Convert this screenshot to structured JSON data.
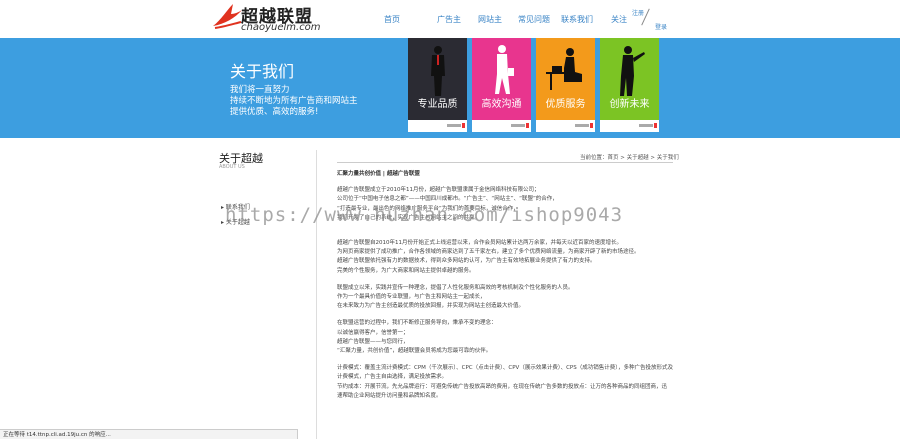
{
  "header": {
    "logo_cn": "超越联盟",
    "logo_en": "chaoyuelm.com",
    "nav": [
      "首页",
      "广告主",
      "网站主",
      "常见问题",
      "联系我们",
      "关注"
    ],
    "login": "注册",
    "register": "登录"
  },
  "banner": {
    "title": "关于我们",
    "desc": [
      "我们将一直努力",
      "持续不断地为所有广告商和网站主",
      "提供优质、高效的服务!"
    ],
    "cards": [
      {
        "label": "专业品质",
        "color": "#2b2b33"
      },
      {
        "label": "高效沟通",
        "color": "#e8358e"
      },
      {
        "label": "优质服务",
        "color": "#f39a1b"
      },
      {
        "label": "创新未来",
        "color": "#7cc424"
      }
    ]
  },
  "sidebar": {
    "title": "关于超越",
    "subtitle": "ABOUT US",
    "items": [
      "联系我们",
      "关于超越"
    ]
  },
  "breadcrumb": "当前位置：首页 > 关于超越 > 关于我们",
  "article": {
    "heading": "汇聚力量共创价值 | 超越广告联盟",
    "p1": [
      "超越广告联盟成立于2010年11月份，超越广告联盟隶属于金信网络科技有限公司；",
      "公司位于“中国电子信息之都”——中国四川成都市。“广告主”、“网站主”、“联盟”的合作，",
      "“打造最专业，最出色的网络推广服务平台”为我们的首要目标，诚信合作，",
      "我们开发了自己的系统，实现广告主与网站主之间的共赢。"
    ],
    "p2": [
      "超越广告联盟自2010年11月份开始正式上线运营以来，合作会员网站累计达两万余家，并每天以近百家的速度增长。",
      "为网页商家提供了成功推广，合作各领域的商家达到了五千家左右，建立了多个优质网络流量，为商家开辟了新的市场途径。",
      "超越广告联盟依托强有力的数据技术，得到众多网站的认可，为广告主有效地拓展业务提供了有力的支持。",
      "完美的个性服务，为广大商家和网站主提供卓越的服务。"
    ],
    "p3": [
      "联盟成立以来，实践并宣传一种理念，提倡了人性化服务和高效的考核机制及个性化服务的人员。",
      "作为一个最具价值的专业联盟，与广告主和网站主一起成长，",
      "在未来致力为广告主创造最优质的投放回报，并实现为网站主创造最大价值。"
    ],
    "p4": [
      "在联盟运营的过程中，我们不断修正服务导向，秉承不变的理念：",
      "以诚信赢得客户，信誉第一；",
      "超越广告联盟——与您同行，",
      "“汇聚力量，共创价值”，超越联盟会员将成为您最可靠的伙伴。"
    ],
    "p5": [
      "计费模式：覆盖主流计费模式：CPM（千次展示）、CPC（点击计费）、CPV（展示效果计费）、CPS（成功销售计费），多种广告投放形式及",
      "计费模式，广告主自由选择，满足投放需求。",
      "节约成本：开展节流，先允品牌运行：可避免传统广告投放高昂的费用，在现在传统广告多数的投放点：让万的各种商品的同组团商，迅",
      "速帮助企业网站提升访问量和品牌知名度。"
    ]
  },
  "watermark": "https://www.huzhan.com/ishop9043",
  "status": "正在等待 t14.ttnp.cli.ad.19ju.cn 的响应..."
}
